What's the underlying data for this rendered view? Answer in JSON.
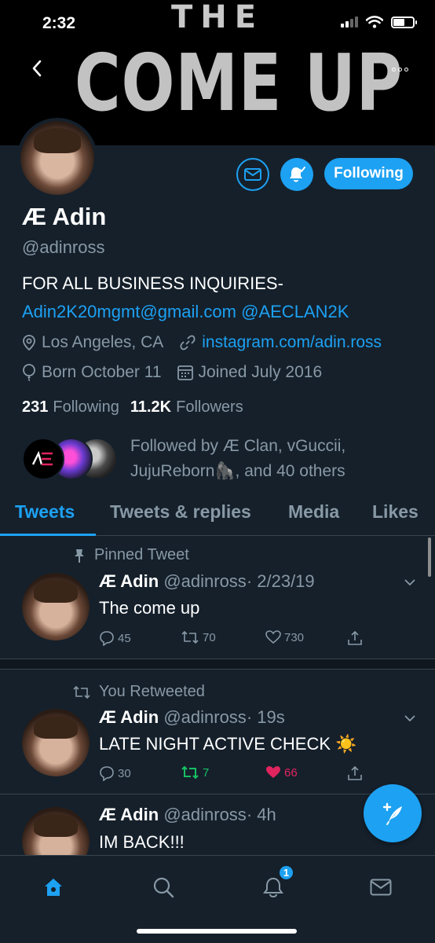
{
  "status_bar": {
    "time": "2:32"
  },
  "banner": {
    "line1": "THE",
    "line2": "COME UP"
  },
  "profile": {
    "name": "Æ Adin",
    "handle": "@adinross",
    "bio_line1": "FOR ALL BUSINESS INQUIRIES-",
    "bio_email": "Adin2K20mgmt@gmail.com",
    "bio_mention": "@AECLAN2K",
    "location": "Los Angeles, CA",
    "website": "instagram.com/adin.ross",
    "birthday": "Born October 11",
    "joined": "Joined July 2016",
    "following_count": "231",
    "following_label": "Following",
    "followers_count": "11.2K",
    "followers_label": "Followers",
    "followed_by_line1": "Followed by Æ Clan, vGuccii,",
    "followed_by_line2": "JujuReborn🦍, and 40 others",
    "following_button": "Following"
  },
  "tabs": [
    {
      "label": "Tweets",
      "active": true
    },
    {
      "label": "Tweets & replies",
      "active": false
    },
    {
      "label": "Media",
      "active": false
    },
    {
      "label": "Likes",
      "active": false
    }
  ],
  "tweets": [
    {
      "context": "Pinned Tweet",
      "name": "Æ Adin",
      "handle": "@adinross",
      "time": "· 2/23/19",
      "text": "The come up",
      "replies": "45",
      "retweets": "70",
      "likes": "730"
    },
    {
      "context": "You Retweeted",
      "name": "Æ Adin",
      "handle": "@adinross",
      "time": "· 19s",
      "text": "LATE NIGHT ACTIVE CHECK ☀️",
      "replies": "30",
      "retweets": "7",
      "likes": "66"
    },
    {
      "context": "",
      "name": "Æ Adin",
      "handle": "@adinross",
      "time": "· 4h",
      "text": "IM BACK!!!"
    }
  ],
  "bottom_nav": {
    "notification_badge": "1"
  },
  "colors": {
    "background": "#15202b",
    "accent": "#1da1f2",
    "muted": "#8899a6",
    "retweet_green": "#17bf63",
    "like_red": "#e0245e"
  },
  "icons": [
    "back-arrow-icon",
    "more-icon",
    "mail-icon",
    "bell-icon",
    "location-icon",
    "link-icon",
    "balloon-icon",
    "calendar-icon",
    "pin-icon",
    "retweet-icon",
    "reply-icon",
    "like-icon",
    "share-icon",
    "chevron-down-icon",
    "compose-icon",
    "home-icon",
    "search-icon",
    "notifications-icon",
    "messages-icon"
  ]
}
